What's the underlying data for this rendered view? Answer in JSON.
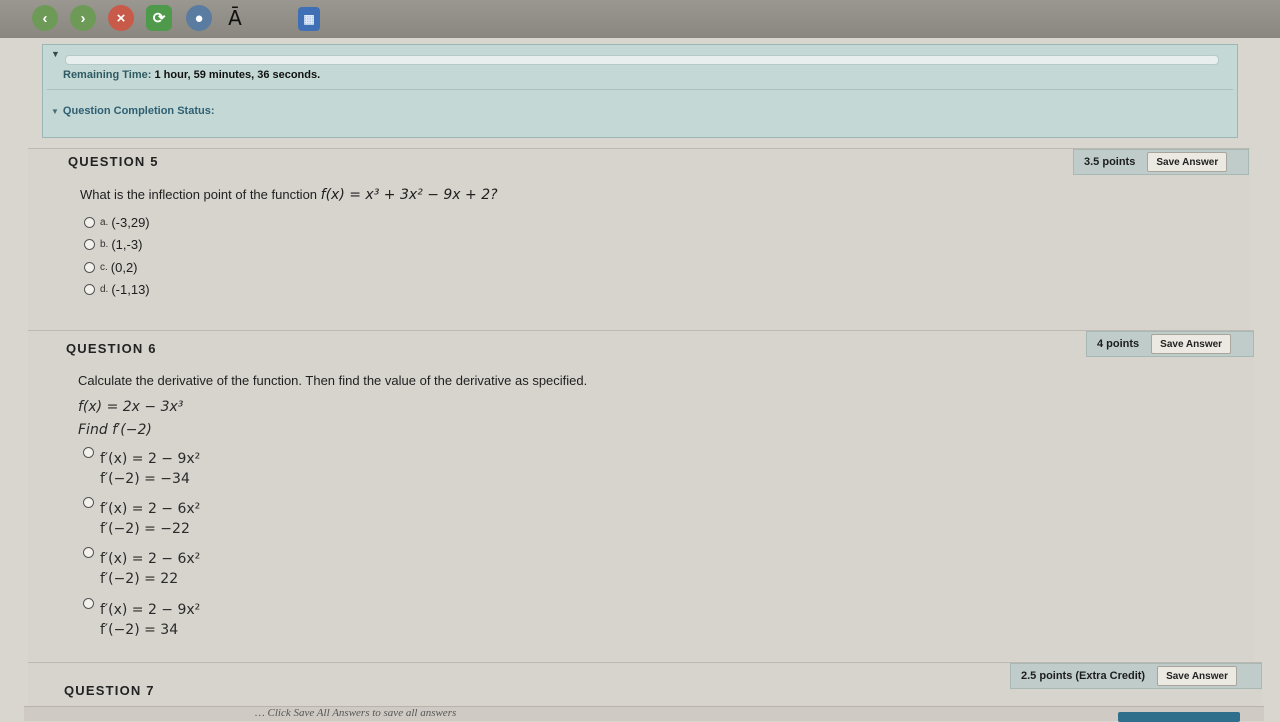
{
  "toolbar": {
    "text_icon": "Ā",
    "calc_icon": "▦"
  },
  "status": {
    "remaining_label": "Remaining Time:",
    "remaining_value": "1 hour, 59 minutes, 36 seconds.",
    "completion_label": "Question Completion Status:"
  },
  "questions": [
    {
      "title": "QUESTION 5",
      "points": "3.5 points",
      "save_label": "Save Answer",
      "prompt": "What is the inflection point of the function",
      "function": "f(x) = x³ + 3x² − 9x + 2?",
      "options": [
        {
          "letter": "a.",
          "text": "(-3,29)"
        },
        {
          "letter": "b.",
          "text": "(1,-3)"
        },
        {
          "letter": "c.",
          "text": "(0,2)"
        },
        {
          "letter": "d.",
          "text": "(-1,13)"
        }
      ]
    },
    {
      "title": "QUESTION 6",
      "points": "4 points",
      "save_label": "Save Answer",
      "prompt": "Calculate the derivative of the function. Then find the value of the derivative as specified.",
      "function": "f(x) = 2x − 3x³",
      "find": "Find f′(−2)",
      "options": [
        {
          "line1": "f′(x) = 2 − 9x²",
          "line2": "f′(−2) = −34"
        },
        {
          "line1": "f′(x) = 2 − 6x²",
          "line2": "f′(−2) = −22"
        },
        {
          "line1": "f′(x) = 2 − 6x²",
          "line2": "f′(−2) = 22"
        },
        {
          "line1": "f′(x) = 2 − 9x²",
          "line2": "f′(−2) = 34"
        }
      ]
    },
    {
      "title": "QUESTION 7",
      "points": "2.5 points (Extra Credit)",
      "save_label": "Save Answer"
    }
  ],
  "footer": {
    "hint": "… Click Save All Answers to save all answers"
  }
}
